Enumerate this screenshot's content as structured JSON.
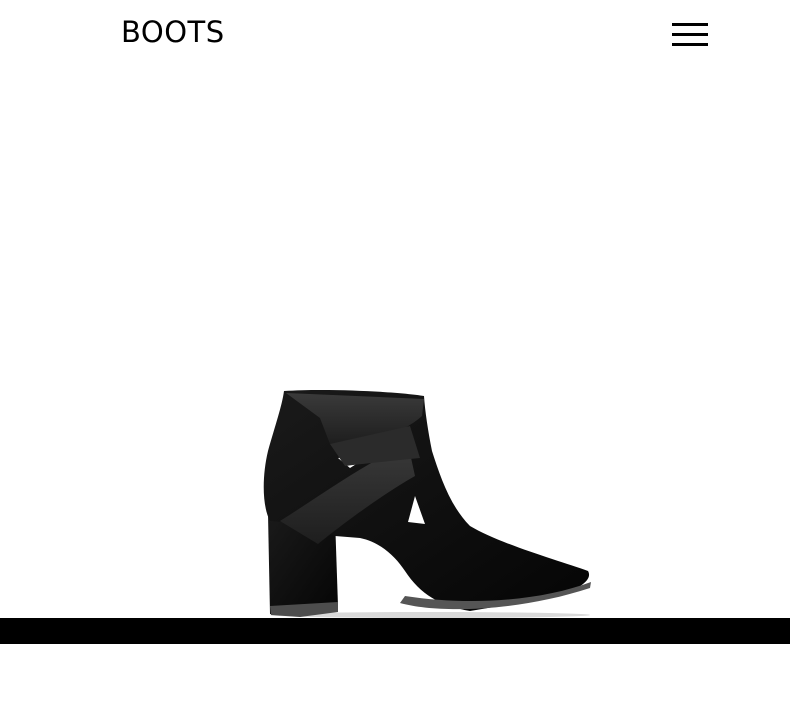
{
  "header": {
    "brand": "BOOTS",
    "menu_icon": "hamburger-menu-icon"
  },
  "hero": {
    "product_icon": "ankle-boot-image"
  },
  "colors": {
    "background": "#ffffff",
    "band": "#000000",
    "text": "#000000"
  }
}
